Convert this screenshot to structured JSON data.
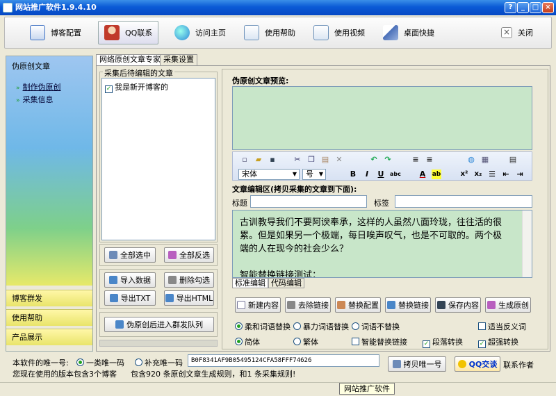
{
  "window": {
    "title": "网站推广软件1.9.4.10",
    "min": "_",
    "max": "□",
    "close": "×",
    "help": "?"
  },
  "toolbar": [
    {
      "label": "博客配置",
      "icon": "document-icon",
      "color": "#3b6fc2"
    },
    {
      "label": "QQ联系",
      "icon": "person-icon",
      "color": "#c0392b"
    },
    {
      "label": "访问主页",
      "icon": "globe-icon",
      "color": "#2a86d6"
    },
    {
      "label": "使用帮助",
      "icon": "help-doc-icon",
      "color": "#6a8fb8"
    },
    {
      "label": "使用视频",
      "icon": "video-doc-icon",
      "color": "#6a8fb8"
    },
    {
      "label": "桌面快捷",
      "icon": "paper-plane-icon",
      "color": "#4a6fb8"
    },
    {
      "label": "关闭",
      "icon": "close-icon",
      "color": "#555555"
    }
  ],
  "sidebar": {
    "head": "伪原创文章",
    "items": [
      "制作伪原创",
      "采集信息"
    ],
    "sections": [
      "博客群发",
      "使用帮助",
      "产品展示"
    ]
  },
  "tabs": [
    "网络原创文章专家",
    "采集设置"
  ],
  "left": {
    "group_label": "采集后待编辑的文章",
    "list_items": [
      {
        "label": "我是新开博客的",
        "checked": true
      }
    ],
    "buttons": {
      "select_all": "全部选中",
      "invert": "全部反选",
      "import": "导入数据",
      "delete_checked": "删除勾选",
      "export_txt": "导出TXT",
      "export_html": "导出HTML",
      "queue": "伪原创后进入群发队列"
    }
  },
  "right": {
    "preview_label": "伪原创文章预览:",
    "editor": {
      "font": "宋体",
      "size": "号"
    },
    "edit_label": "文章编辑区(拷贝采集的文章到下面):",
    "title_label": "标题",
    "title_value": "",
    "tag_label": "标签",
    "tag_value": "",
    "body_lines": [
      "古训教导我们不要阿谀奉承，这样的人虽然八面玲珑，往往活的很",
      "累。但是如果另一个极端，每日唉声叹气，也是不可取的。两个极",
      "端的人在现今的社会少么？",
      "",
      "智能替换链接测试："
    ],
    "mode_tabs": [
      "标准编辑",
      "代码编辑"
    ],
    "actions": [
      "新建内容",
      "去除链接",
      "替换配置",
      "替换链接",
      "保存内容",
      "生成原创"
    ],
    "options_row1": [
      {
        "label": "柔和词语替换",
        "type": "radio",
        "on": true
      },
      {
        "label": "暴力词语替换",
        "type": "radio",
        "on": false
      },
      {
        "label": "词语不替换",
        "type": "radio",
        "on": false
      },
      {
        "label": "适当反义词",
        "type": "check",
        "on": false
      }
    ],
    "options_row2": [
      {
        "label": "简体",
        "type": "radio",
        "on": true
      },
      {
        "label": "繁体",
        "type": "radio",
        "on": false
      },
      {
        "label": "智能替换链接",
        "type": "check",
        "on": false
      },
      {
        "label": "段落转换",
        "type": "check",
        "on": true
      },
      {
        "label": "超强转换",
        "type": "check",
        "on": true
      }
    ]
  },
  "bottom": {
    "uid_label": "本软件的唯一号:",
    "opt1": "一类唯一码",
    "opt2": "补充唯一码",
    "uid_value": "B0F8341AF9B05495124CFA58FFF74626",
    "copy_btn": "拷贝唯一号",
    "qq_btn": "QQ交谈",
    "contact": "联系作者",
    "version_text": "您现在使用的版本包含3个博客",
    "rules_text": "包含920 条原创文章生成规则，和1 条采集规则!"
  },
  "status": {
    "tooltip": "网站推广软件"
  }
}
